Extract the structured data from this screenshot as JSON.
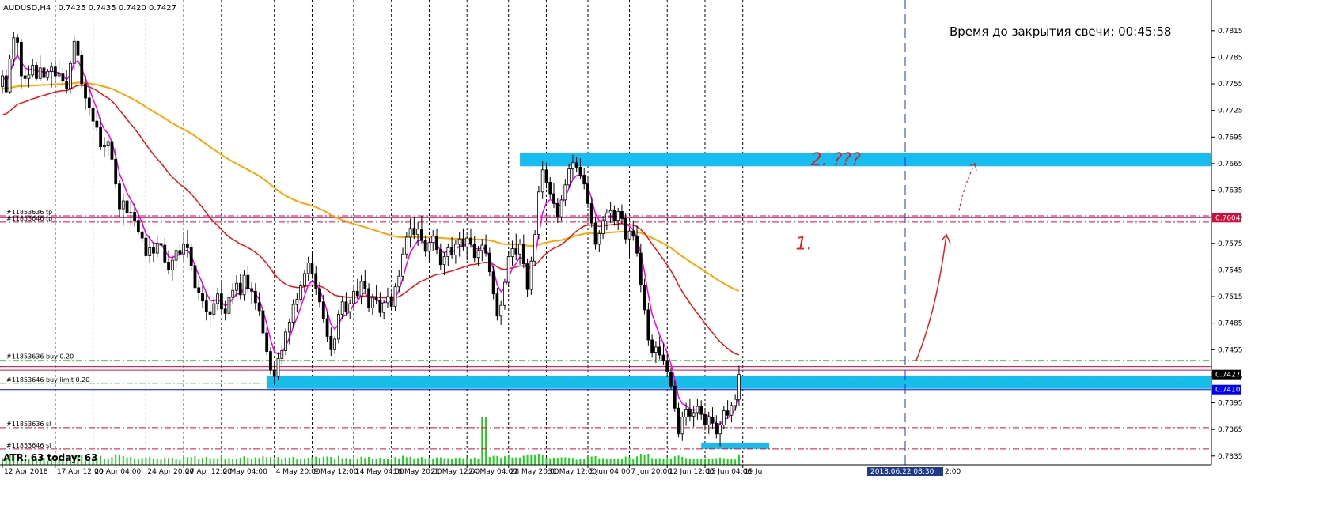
{
  "chart_data": {
    "type": "candlestick",
    "header": {
      "symbol": "AUDUSD,H4",
      "ohlc": "0.7425 0.7435 0.7420 0.7427"
    },
    "countdown": "Время до закрытия свечи: 00:45:58",
    "atr": "ATR: 63  today: 63",
    "y_axis": {
      "range": [
        0.7325,
        0.783
      ],
      "ticks": [
        "0.7815",
        "0.7785",
        "0.7755",
        "0.7725",
        "0.7695",
        "0.7665",
        "0.7635",
        "0.7605",
        "0.7575",
        "0.7545",
        "0.7515",
        "0.7485",
        "0.7455",
        "0.7425",
        "0.7395",
        "0.7365",
        "0.7335"
      ]
    },
    "x_axis": {
      "n_bars": 240,
      "labels": [
        {
          "bar": 0,
          "text": "12 Apr 2018"
        },
        {
          "bar": 14,
          "text": "17 Apr 12:00"
        },
        {
          "bar": 24,
          "text": "20 Apr 04:00"
        },
        {
          "bar": 38,
          "text": "24 Apr 20:00"
        },
        {
          "bar": 48,
          "text": "27 Apr 12:00"
        },
        {
          "bar": 58,
          "text": "2 May 04:00"
        },
        {
          "bar": 72,
          "text": "4 May 20:00"
        },
        {
          "bar": 82,
          "text": "9 May 12:00"
        },
        {
          "bar": 93,
          "text": "14 May 04:00"
        },
        {
          "bar": 103,
          "text": "16 May 20:00"
        },
        {
          "bar": 113,
          "text": "21 May 12:00"
        },
        {
          "bar": 123,
          "text": "24 May 04:00"
        },
        {
          "bar": 134,
          "text": "28 May 20:00"
        },
        {
          "bar": 144,
          "text": "31 May 12:00"
        },
        {
          "bar": 155,
          "text": "5 Jun 04:00"
        },
        {
          "bar": 166,
          "text": "7 Jun 20:00"
        },
        {
          "bar": 176,
          "text": "12 Jun 12:00"
        },
        {
          "bar": 186,
          "text": "15 Jun 04:00"
        },
        {
          "bar": 196,
          "text": "19 Ju"
        }
      ],
      "current_time_label": "2018.06.22 08:30",
      "trailing_text": "2:00"
    },
    "price_marks": [
      {
        "value": 0.7604,
        "label": "0.7604",
        "color": "#d60a3c"
      },
      {
        "value": 0.7427,
        "label": "0.7427",
        "color": "#000000"
      },
      {
        "value": 0.741,
        "label": "0.7410",
        "color": "#0000ff"
      }
    ],
    "order_lines": [
      {
        "label": "#11853636 tp",
        "value": 0.7606,
        "color": "#d60a3c",
        "style": "dashdot"
      },
      {
        "label": "#11853646 tp",
        "value": 0.7599,
        "color": "#d60a3c",
        "style": "dashdot"
      },
      {
        "label": "#11853636 buy 0.20",
        "value": 0.7443,
        "color": "#22cc22",
        "style": "dashdot"
      },
      {
        "label": "#11853646 buy limit 0.20",
        "value": 0.7417,
        "color": "#22cc22",
        "style": "dashdot"
      },
      {
        "label": "#11853636 sl",
        "value": 0.7367,
        "color": "#d60a3c",
        "style": "dashdot"
      },
      {
        "label": "#11853646 sl",
        "value": 0.7343,
        "color": "#d60a3c",
        "style": "dashdot"
      }
    ],
    "horizontal_lines": [
      {
        "value": 0.7604,
        "color": "#b8007a"
      },
      {
        "value": 0.7436,
        "color": "#d60a3c"
      },
      {
        "value": 0.7432,
        "color": "#d60a3c"
      },
      {
        "value": 0.741,
        "color": "#0000ff"
      }
    ],
    "zones": [
      {
        "from_bar": 137,
        "to_bar": 240,
        "low": 0.7662,
        "high": 0.7677,
        "color": "#15bdf0"
      },
      {
        "from_bar": 70,
        "to_bar": 240,
        "low": 0.7411,
        "high": 0.7425,
        "color": "#15bdf0"
      },
      {
        "from_bar": 185,
        "to_bar": 203,
        "low": 0.7343,
        "high": 0.735,
        "color": "#15bdf0"
      }
    ],
    "annotations": [
      {
        "text": "1.",
        "bar": 210,
        "value": 0.7568,
        "color": "#e02020"
      },
      {
        "text": "2. ???",
        "bar": 214,
        "value": 0.7663,
        "color": "#e02020"
      }
    ],
    "candles": [
      [
        0.7752,
        0.7771,
        0.7744,
        0.7764
      ],
      [
        0.7764,
        0.7772,
        0.7745,
        0.7746
      ],
      [
        0.7746,
        0.7788,
        0.7744,
        0.7783
      ],
      [
        0.7783,
        0.7814,
        0.7775,
        0.7807
      ],
      [
        0.7807,
        0.7811,
        0.7786,
        0.7802
      ],
      [
        0.7802,
        0.7806,
        0.775,
        0.7764
      ],
      [
        0.7764,
        0.7778,
        0.7755,
        0.7761
      ],
      [
        0.7761,
        0.7776,
        0.7751,
        0.7765
      ],
      [
        0.7765,
        0.7783,
        0.7762,
        0.7776
      ],
      [
        0.7776,
        0.778,
        0.7759,
        0.7761
      ],
      [
        0.7761,
        0.7787,
        0.7758,
        0.7773
      ],
      [
        0.7773,
        0.7788,
        0.776,
        0.7762
      ],
      [
        0.7762,
        0.7772,
        0.7759,
        0.7769
      ],
      [
        0.7769,
        0.7779,
        0.7751,
        0.7774
      ],
      [
        0.7774,
        0.7782,
        0.7756,
        0.7764
      ],
      [
        0.7764,
        0.7781,
        0.7761,
        0.7767
      ],
      [
        0.7767,
        0.7773,
        0.7752,
        0.7758
      ],
      [
        0.7758,
        0.7771,
        0.7744,
        0.775
      ],
      [
        0.775,
        0.7781,
        0.7744,
        0.7778
      ],
      [
        0.7778,
        0.781,
        0.777,
        0.7803
      ],
      [
        0.7803,
        0.7818,
        0.7776,
        0.7787
      ],
      [
        0.7787,
        0.7793,
        0.775,
        0.7755
      ],
      [
        0.7755,
        0.7764,
        0.7726,
        0.7739
      ],
      [
        0.7739,
        0.7752,
        0.7719,
        0.7728
      ],
      [
        0.7728,
        0.7733,
        0.7702,
        0.7713
      ],
      [
        0.7713,
        0.7725,
        0.7701,
        0.7706
      ],
      [
        0.7706,
        0.7717,
        0.768,
        0.7684
      ],
      [
        0.7684,
        0.7695,
        0.7673,
        0.7685
      ],
      [
        0.7685,
        0.7694,
        0.7674,
        0.769
      ],
      [
        0.769,
        0.7698,
        0.7667,
        0.767
      ],
      [
        0.767,
        0.7683,
        0.7637,
        0.7642
      ],
      [
        0.7642,
        0.7646,
        0.7605,
        0.7614
      ],
      [
        0.7614,
        0.7631,
        0.7595,
        0.7623
      ],
      [
        0.7623,
        0.7636,
        0.7606,
        0.7609
      ],
      [
        0.7609,
        0.7627,
        0.7595,
        0.761
      ],
      [
        0.761,
        0.762,
        0.7594,
        0.7601
      ],
      [
        0.7601,
        0.7609,
        0.7585,
        0.7588
      ],
      [
        0.7588,
        0.7603,
        0.7576,
        0.7581
      ],
      [
        0.7581,
        0.7585,
        0.7557,
        0.7561
      ],
      [
        0.7561,
        0.7584,
        0.7553,
        0.757
      ],
      [
        0.757,
        0.7576,
        0.7554,
        0.7564
      ],
      [
        0.7564,
        0.7584,
        0.7559,
        0.7575
      ],
      [
        0.7575,
        0.7587,
        0.7568,
        0.7573
      ],
      [
        0.7573,
        0.7581,
        0.7552,
        0.7554
      ],
      [
        0.7554,
        0.7567,
        0.754,
        0.7545
      ],
      [
        0.7545,
        0.7561,
        0.7533,
        0.7556
      ],
      [
        0.7556,
        0.757,
        0.7547,
        0.7567
      ],
      [
        0.7567,
        0.7574,
        0.7557,
        0.7563
      ],
      [
        0.7563,
        0.7588,
        0.7555,
        0.7574
      ],
      [
        0.7574,
        0.759,
        0.7559,
        0.757
      ],
      [
        0.757,
        0.7575,
        0.7544,
        0.755
      ],
      [
        0.755,
        0.7555,
        0.752,
        0.7525
      ],
      [
        0.7525,
        0.7532,
        0.751,
        0.7519
      ],
      [
        0.7519,
        0.753,
        0.7502,
        0.751
      ],
      [
        0.751,
        0.752,
        0.7488,
        0.7498
      ],
      [
        0.7498,
        0.7506,
        0.748,
        0.7495
      ],
      [
        0.7495,
        0.7515,
        0.749,
        0.7507
      ],
      [
        0.7507,
        0.7525,
        0.75,
        0.7518
      ],
      [
        0.7518,
        0.7531,
        0.7495,
        0.7501
      ],
      [
        0.7501,
        0.751,
        0.7488,
        0.7496
      ],
      [
        0.7496,
        0.752,
        0.7493,
        0.7514
      ],
      [
        0.7514,
        0.753,
        0.7506,
        0.7522
      ],
      [
        0.7522,
        0.7539,
        0.7515,
        0.753
      ],
      [
        0.753,
        0.754,
        0.7512,
        0.7517
      ],
      [
        0.7517,
        0.7545,
        0.751,
        0.7539
      ],
      [
        0.7539,
        0.7549,
        0.752,
        0.7524
      ],
      [
        0.7524,
        0.7531,
        0.7507,
        0.7521
      ],
      [
        0.7521,
        0.753,
        0.75,
        0.7508
      ],
      [
        0.7508,
        0.752,
        0.7493,
        0.7499
      ],
      [
        0.7499,
        0.7505,
        0.747,
        0.7474
      ],
      [
        0.7474,
        0.748,
        0.7449,
        0.7453
      ],
      [
        0.7453,
        0.7458,
        0.7427,
        0.7432
      ],
      [
        0.7432,
        0.744,
        0.7415,
        0.7425
      ],
      [
        0.7425,
        0.7452,
        0.7421,
        0.7445
      ],
      [
        0.7445,
        0.746,
        0.7438,
        0.7454
      ],
      [
        0.7454,
        0.7479,
        0.7449,
        0.7475
      ],
      [
        0.7475,
        0.749,
        0.7461,
        0.7486
      ],
      [
        0.7486,
        0.7512,
        0.748,
        0.7506
      ],
      [
        0.7506,
        0.7519,
        0.7497,
        0.7512
      ],
      [
        0.7512,
        0.7532,
        0.7509,
        0.7527
      ],
      [
        0.7527,
        0.7545,
        0.752,
        0.7541
      ],
      [
        0.7541,
        0.756,
        0.7532,
        0.7553
      ],
      [
        0.7553,
        0.7565,
        0.7535,
        0.7541
      ],
      [
        0.7541,
        0.755,
        0.7517,
        0.7524
      ],
      [
        0.7524,
        0.7531,
        0.7503,
        0.7509
      ],
      [
        0.7509,
        0.7517,
        0.7485,
        0.749
      ],
      [
        0.749,
        0.7498,
        0.7464,
        0.747
      ],
      [
        0.747,
        0.748,
        0.7448,
        0.7455
      ],
      [
        0.7455,
        0.747,
        0.745,
        0.7467
      ],
      [
        0.7467,
        0.75,
        0.7462,
        0.7495
      ],
      [
        0.7495,
        0.7515,
        0.7489,
        0.7509
      ],
      [
        0.7509,
        0.752,
        0.7493,
        0.7498
      ],
      [
        0.7498,
        0.7512,
        0.749,
        0.7507
      ],
      [
        0.7507,
        0.7528,
        0.7503,
        0.7521
      ],
      [
        0.7521,
        0.7535,
        0.7512,
        0.7516
      ],
      [
        0.7516,
        0.7539,
        0.7506,
        0.7532
      ],
      [
        0.7532,
        0.7545,
        0.7518,
        0.7524
      ],
      [
        0.7524,
        0.753,
        0.7498,
        0.7502
      ],
      [
        0.7502,
        0.7518,
        0.7494,
        0.7514
      ],
      [
        0.7514,
        0.7528,
        0.7506,
        0.7511
      ],
      [
        0.7511,
        0.752,
        0.7492,
        0.7497
      ],
      [
        0.7497,
        0.7511,
        0.7489,
        0.7508
      ],
      [
        0.7508,
        0.7525,
        0.7502,
        0.7515
      ],
      [
        0.7515,
        0.752,
        0.75,
        0.7504
      ],
      [
        0.7504,
        0.753,
        0.7499,
        0.7526
      ],
      [
        0.7526,
        0.7545,
        0.752,
        0.7538
      ],
      [
        0.7538,
        0.757,
        0.7532,
        0.7563
      ],
      [
        0.7563,
        0.7588,
        0.7558,
        0.7582
      ],
      [
        0.7582,
        0.7603,
        0.757,
        0.7592
      ],
      [
        0.7592,
        0.7605,
        0.758,
        0.7585
      ],
      [
        0.7585,
        0.7599,
        0.7572,
        0.7591
      ],
      [
        0.7591,
        0.7606,
        0.7575,
        0.7579
      ],
      [
        0.7579,
        0.7584,
        0.756,
        0.7566
      ],
      [
        0.7566,
        0.7581,
        0.7555,
        0.7576
      ],
      [
        0.7576,
        0.759,
        0.7566,
        0.7583
      ],
      [
        0.7583,
        0.7592,
        0.7563,
        0.7568
      ],
      [
        0.7568,
        0.7575,
        0.7545,
        0.7551
      ],
      [
        0.7551,
        0.7565,
        0.7539,
        0.756
      ],
      [
        0.756,
        0.7575,
        0.7549,
        0.757
      ],
      [
        0.757,
        0.7582,
        0.7558,
        0.7562
      ],
      [
        0.7562,
        0.7579,
        0.7552,
        0.7574
      ],
      [
        0.7574,
        0.7588,
        0.756,
        0.758
      ],
      [
        0.758,
        0.7592,
        0.7567,
        0.7571
      ],
      [
        0.7571,
        0.7584,
        0.7556,
        0.7581
      ],
      [
        0.7581,
        0.7592,
        0.757,
        0.7574
      ],
      [
        0.7574,
        0.7583,
        0.7554,
        0.7559
      ],
      [
        0.7559,
        0.7572,
        0.7549,
        0.7567
      ],
      [
        0.7567,
        0.758,
        0.7555,
        0.7573
      ],
      [
        0.7573,
        0.7585,
        0.756,
        0.7564
      ],
      [
        0.7564,
        0.757,
        0.7538,
        0.7543
      ],
      [
        0.7543,
        0.755,
        0.7512,
        0.7518
      ],
      [
        0.7518,
        0.7525,
        0.7488,
        0.7493
      ],
      [
        0.7493,
        0.751,
        0.7483,
        0.7505
      ],
      [
        0.7505,
        0.7535,
        0.75,
        0.7531
      ],
      [
        0.7531,
        0.7566,
        0.7526,
        0.756
      ],
      [
        0.756,
        0.7578,
        0.7549,
        0.7569
      ],
      [
        0.7569,
        0.7586,
        0.7556,
        0.7563
      ],
      [
        0.7563,
        0.758,
        0.7551,
        0.7574
      ],
      [
        0.7574,
        0.7585,
        0.7547,
        0.7552
      ],
      [
        0.7552,
        0.7558,
        0.7515,
        0.7523
      ],
      [
        0.7523,
        0.756,
        0.7517,
        0.7555
      ],
      [
        0.7555,
        0.759,
        0.755,
        0.7585
      ],
      [
        0.7585,
        0.764,
        0.758,
        0.7633
      ],
      [
        0.7633,
        0.7668,
        0.7625,
        0.7658
      ],
      [
        0.7658,
        0.7666,
        0.7637,
        0.7644
      ],
      [
        0.7644,
        0.765,
        0.7625,
        0.7631
      ],
      [
        0.7631,
        0.7643,
        0.7615,
        0.762
      ],
      [
        0.762,
        0.7626,
        0.7598,
        0.7605
      ],
      [
        0.7605,
        0.763,
        0.76,
        0.7624
      ],
      [
        0.7624,
        0.7647,
        0.7617,
        0.7641
      ],
      [
        0.7641,
        0.7665,
        0.7637,
        0.7659
      ],
      [
        0.7659,
        0.7675,
        0.7648,
        0.7666
      ],
      [
        0.7666,
        0.7673,
        0.7655,
        0.7661
      ],
      [
        0.7661,
        0.7671,
        0.7648,
        0.7652
      ],
      [
        0.7652,
        0.766,
        0.7636,
        0.7642
      ],
      [
        0.7642,
        0.765,
        0.7615,
        0.762
      ],
      [
        0.762,
        0.7627,
        0.7593,
        0.7598
      ],
      [
        0.7598,
        0.7604,
        0.7568,
        0.7574
      ],
      [
        0.7574,
        0.759,
        0.7565,
        0.7586
      ],
      [
        0.7586,
        0.7606,
        0.758,
        0.76
      ],
      [
        0.76,
        0.7614,
        0.759,
        0.7609
      ],
      [
        0.7609,
        0.7622,
        0.7598,
        0.7612
      ],
      [
        0.7612,
        0.7618,
        0.7595,
        0.7601
      ],
      [
        0.7601,
        0.7615,
        0.759,
        0.7611
      ],
      [
        0.7611,
        0.7619,
        0.7597,
        0.7603
      ],
      [
        0.7603,
        0.7609,
        0.7575,
        0.758
      ],
      [
        0.758,
        0.7593,
        0.756,
        0.7589
      ],
      [
        0.7589,
        0.7601,
        0.7578,
        0.7583
      ],
      [
        0.7583,
        0.7595,
        0.756,
        0.7564
      ],
      [
        0.7564,
        0.7575,
        0.752,
        0.7528
      ],
      [
        0.7528,
        0.7535,
        0.7495,
        0.75
      ],
      [
        0.75,
        0.7508,
        0.746,
        0.7466
      ],
      [
        0.7466,
        0.7472,
        0.7446,
        0.7452
      ],
      [
        0.7452,
        0.7465,
        0.744,
        0.7458
      ],
      [
        0.7458,
        0.747,
        0.7444,
        0.7449
      ],
      [
        0.7449,
        0.7462,
        0.7438,
        0.7443
      ],
      [
        0.7443,
        0.745,
        0.7424,
        0.743
      ],
      [
        0.743,
        0.7435,
        0.741,
        0.7414
      ],
      [
        0.7414,
        0.742,
        0.7385,
        0.7389
      ],
      [
        0.7389,
        0.7395,
        0.7356,
        0.736
      ],
      [
        0.736,
        0.7385,
        0.7352,
        0.7379
      ],
      [
        0.7379,
        0.7395,
        0.7369,
        0.7388
      ],
      [
        0.7388,
        0.7399,
        0.7374,
        0.738
      ],
      [
        0.738,
        0.7391,
        0.7368,
        0.7384
      ],
      [
        0.7384,
        0.74,
        0.7376,
        0.7391
      ],
      [
        0.7391,
        0.7398,
        0.7376,
        0.7382
      ],
      [
        0.7382,
        0.7388,
        0.7364,
        0.737
      ],
      [
        0.737,
        0.7385,
        0.736,
        0.7379
      ],
      [
        0.7379,
        0.739,
        0.7366,
        0.7372
      ],
      [
        0.7372,
        0.7381,
        0.7355,
        0.736
      ],
      [
        0.736,
        0.7375,
        0.7346,
        0.737
      ],
      [
        0.737,
        0.7391,
        0.7365,
        0.7386
      ],
      [
        0.7386,
        0.7398,
        0.7377,
        0.7381
      ],
      [
        0.7381,
        0.7396,
        0.7373,
        0.7392
      ],
      [
        0.7392,
        0.7405,
        0.7386,
        0.7399
      ],
      [
        0.7399,
        0.7437,
        0.7392,
        0.7427
      ]
    ]
  }
}
